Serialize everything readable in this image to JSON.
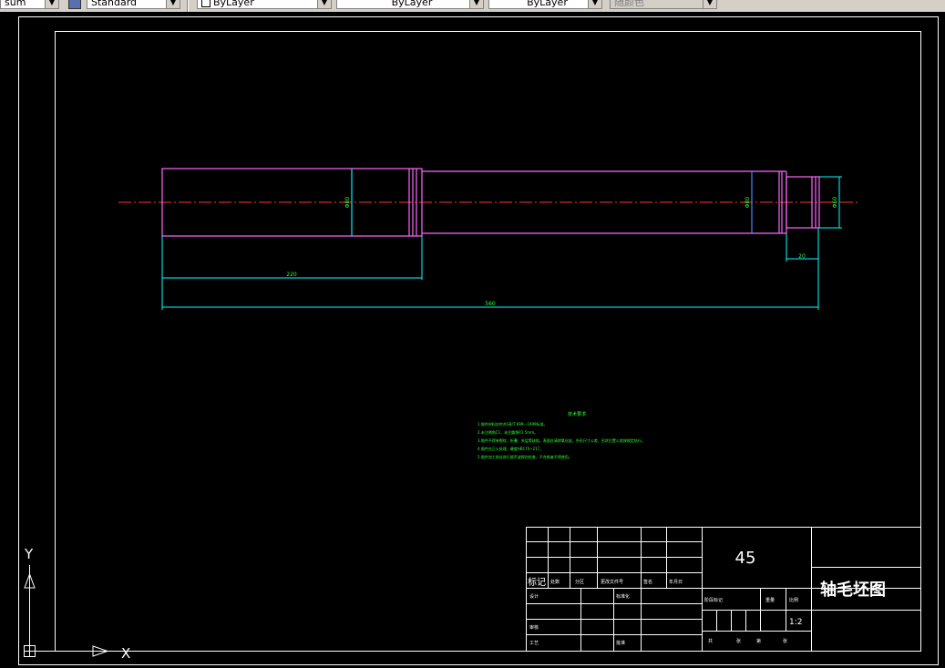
{
  "toolbar": {
    "layer_value": "sum",
    "textstyle_value": "Standard",
    "color_value": "ByLayer",
    "linetype_value": "ByLayer",
    "lineweight_value": "ByLayer",
    "plotstyle_value": "随颜色"
  },
  "drawing": {
    "dim_bore_left": "Φ80",
    "dim_bore_right": "Φ80",
    "dim_end_dia": "Φ60",
    "dim_right_step": "20",
    "dim_left_length": "220",
    "dim_total_length": "560",
    "notes_title": "技术要求",
    "notes": [
      "1.锻件材料应符合GB/T 699—1999标准。",
      "2.未注倒角C1，未注圆角R1.5mm。",
      "3.锻件不得有裂纹、折叠、夹层等缺陷，表面应清除氧化皮，外形尺寸公差、形状位置公差按规定执行。",
      "4.锻件应正火处理，硬度HB170~217。",
      "5.锻件加工前应进行超声波探伤检查，不合格者不得使用。"
    ]
  },
  "title_block": {
    "material": "45",
    "title": "轴毛坯图",
    "scale": "1:2",
    "row_labels": {
      "mark": "标记",
      "count": "处数",
      "zone": "分区",
      "change_doc": "更改文件号",
      "sign": "签名",
      "date": "年月日",
      "design": "设计",
      "standardize": "标准化",
      "check": "审核",
      "craft": "工艺",
      "approve": "批准",
      "stage_mark": "阶段标记",
      "weight": "重量",
      "ratio": "比例",
      "sheet_total": "共",
      "sheet": "张",
      "sheet_no": "第"
    }
  },
  "ucs": {
    "y_label": "Y",
    "x_label": "X"
  },
  "colors": {
    "background": "#000000",
    "frame": "#ffffff",
    "outline": "#ff66ff",
    "centerline": "#ff3333",
    "dimension": "#00ffff",
    "notes": "#33ff33",
    "blue_line": "#4488ff"
  }
}
